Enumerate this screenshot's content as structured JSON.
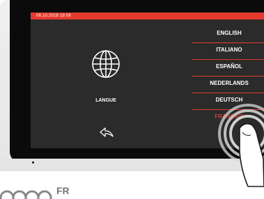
{
  "status_bar": {
    "datetime": "06.10.2018  19:08"
  },
  "main": {
    "title": "LANGUE",
    "icon": "globe-icon",
    "back_icon": "back-arrow-icon"
  },
  "languages": {
    "items": [
      {
        "label": "ENGLISH",
        "selected": false
      },
      {
        "label": "ITALIANO",
        "selected": false
      },
      {
        "label": "ESPAÑOL",
        "selected": false
      },
      {
        "label": "NEDERLANDS",
        "selected": false
      },
      {
        "label": "DEUTSCH",
        "selected": false
      },
      {
        "label": "FRANÇAIS",
        "selected": true
      }
    ]
  },
  "footer": {
    "label": "FR"
  },
  "colors": {
    "accent": "#e53b2e",
    "screen_bg": "#2b2b2b",
    "text": "#ffffff"
  }
}
